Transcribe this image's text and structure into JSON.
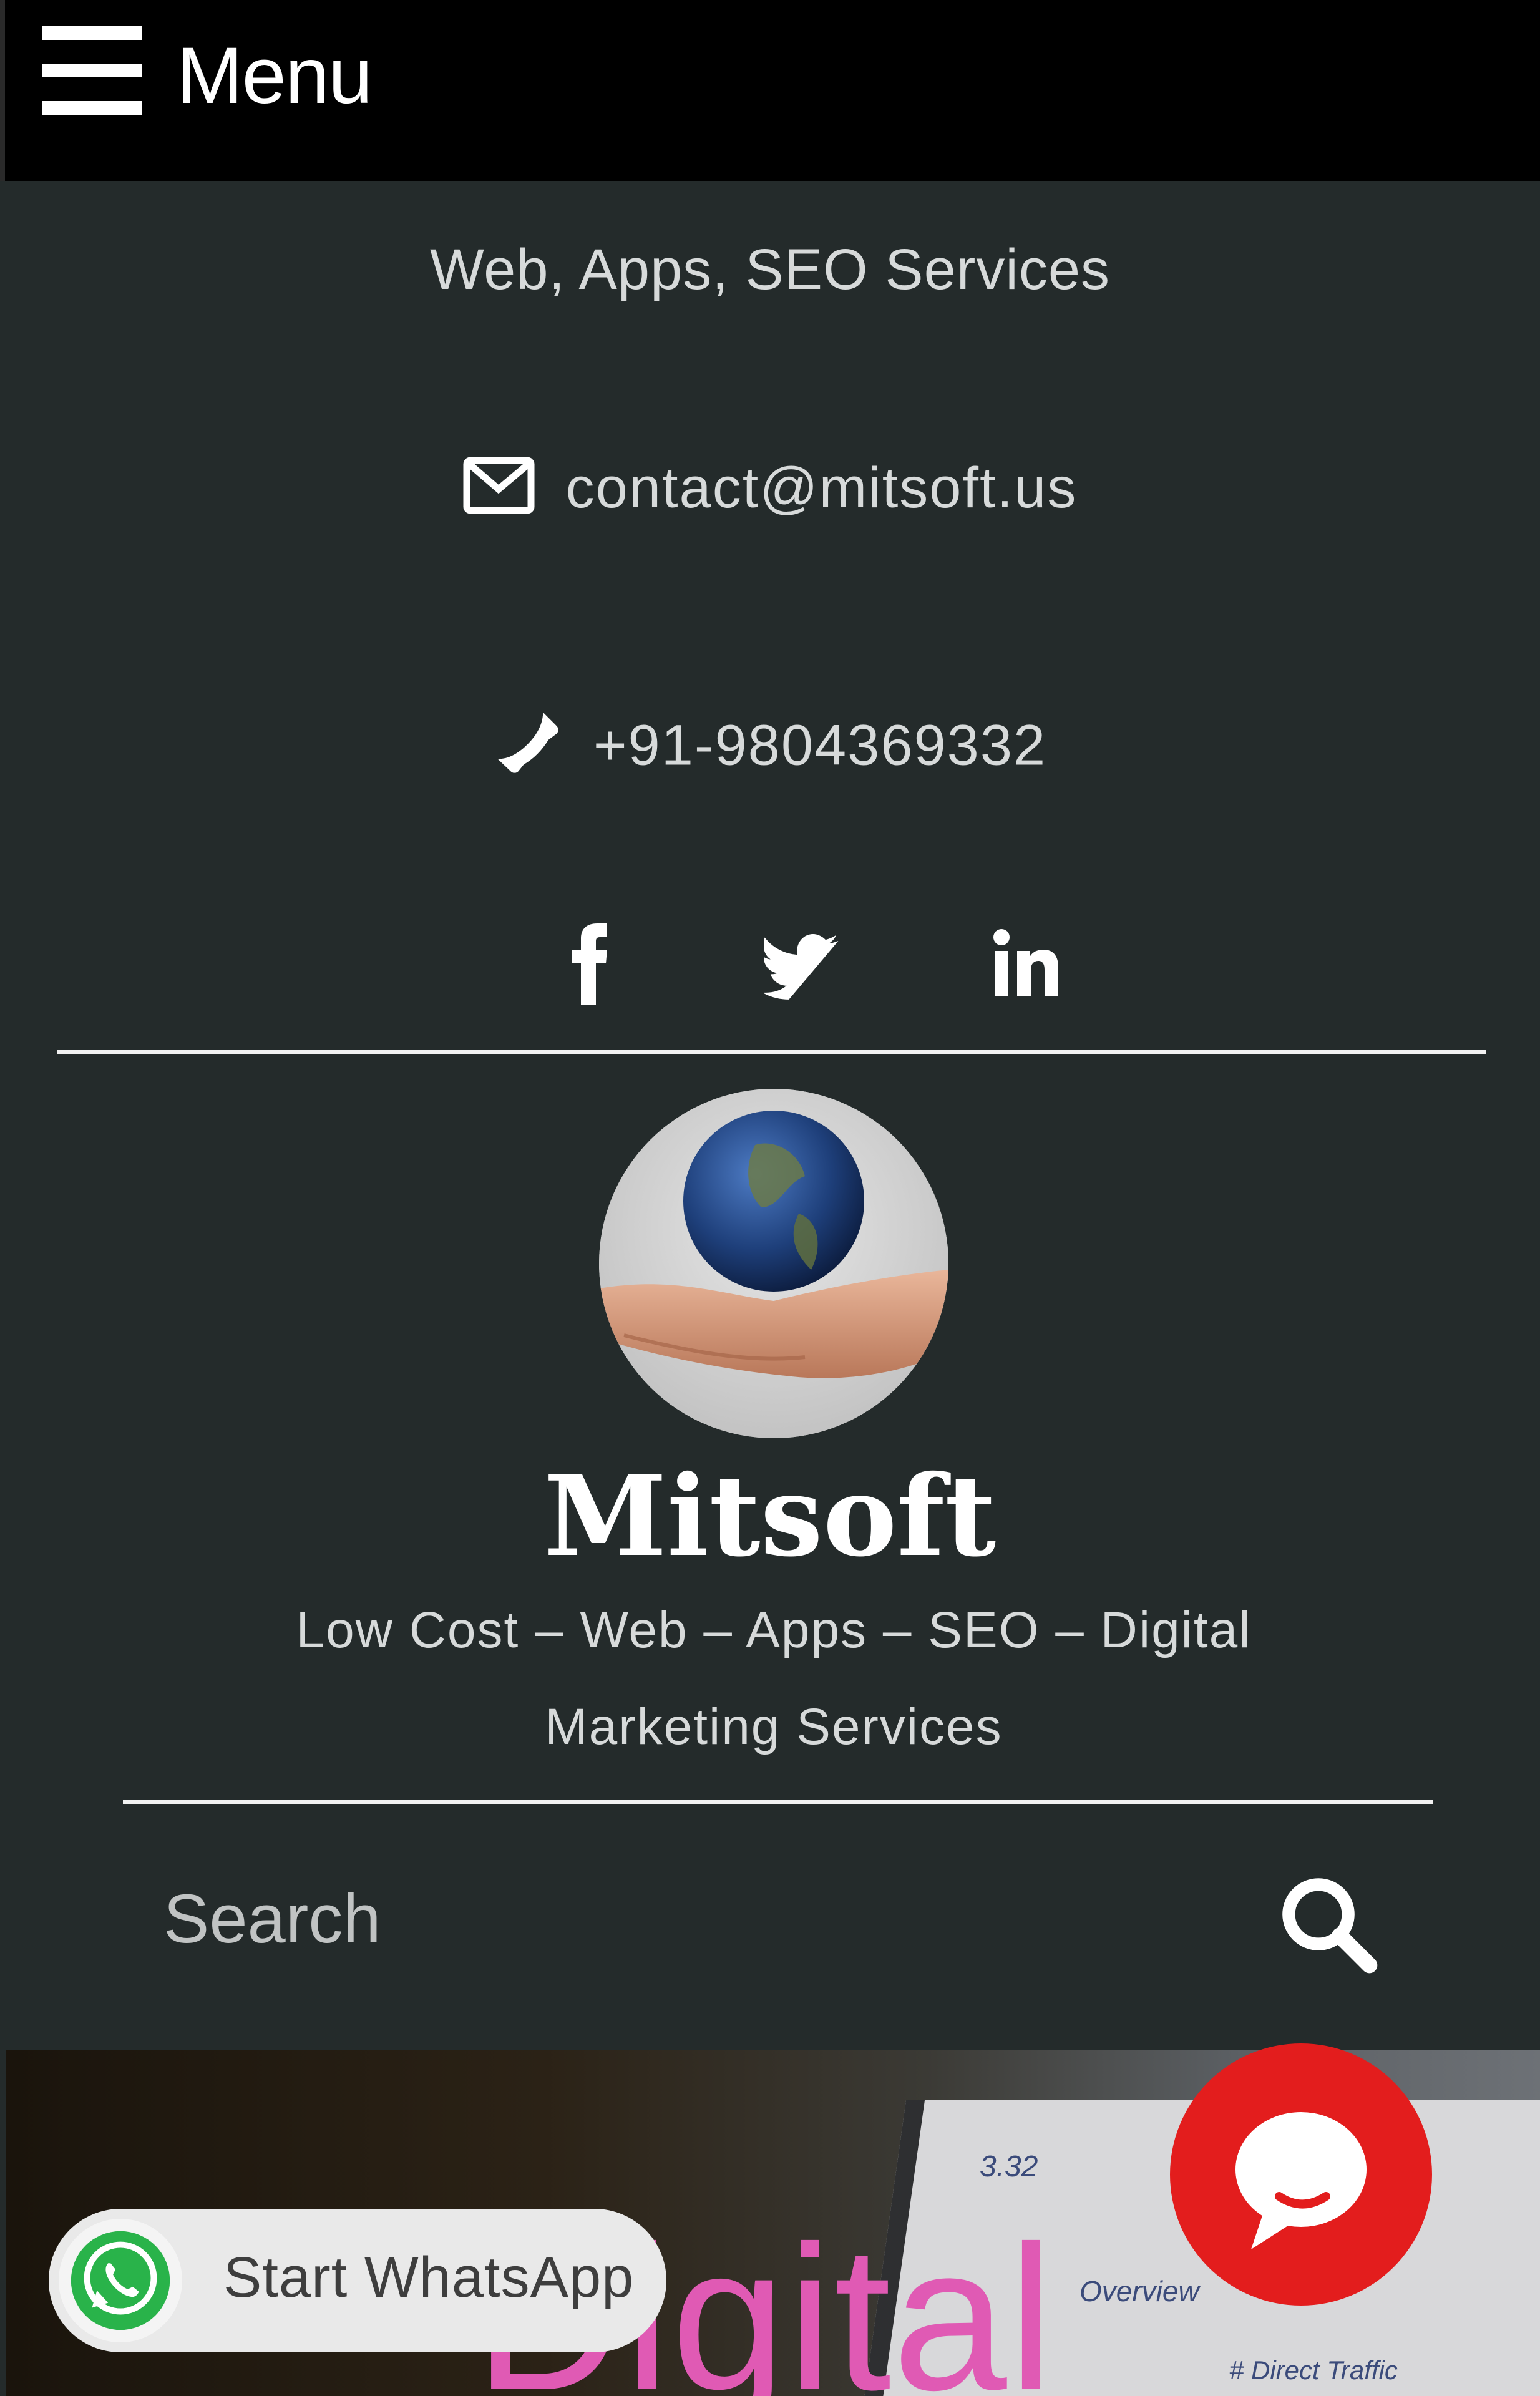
{
  "menu": {
    "label": "Menu"
  },
  "header": {
    "tagline": "Web, Apps, SEO Services",
    "email": "contact@mitsoft.us",
    "phone": "+91-9804369332",
    "social": [
      "facebook-icon",
      "twitter-icon",
      "linkedin-icon"
    ]
  },
  "site": {
    "title": "Mitsoft",
    "description": "Low Cost – Web – Apps – SEO – Digital Marketing Services"
  },
  "search": {
    "placeholder": "Search"
  },
  "hero": {
    "text": "Digital",
    "screen_text_1": "3.32",
    "screen_text_2": "Overview",
    "screen_text_3": "# Direct Traffic"
  },
  "whatsapp": {
    "label": "Start WhatsApp"
  },
  "colors": {
    "header_bg": "#242b2b",
    "menu_bg": "#000000",
    "chat_red": "#e31d1d",
    "whatsapp_green": "#25d366",
    "hero_text": "#e05ab4"
  }
}
